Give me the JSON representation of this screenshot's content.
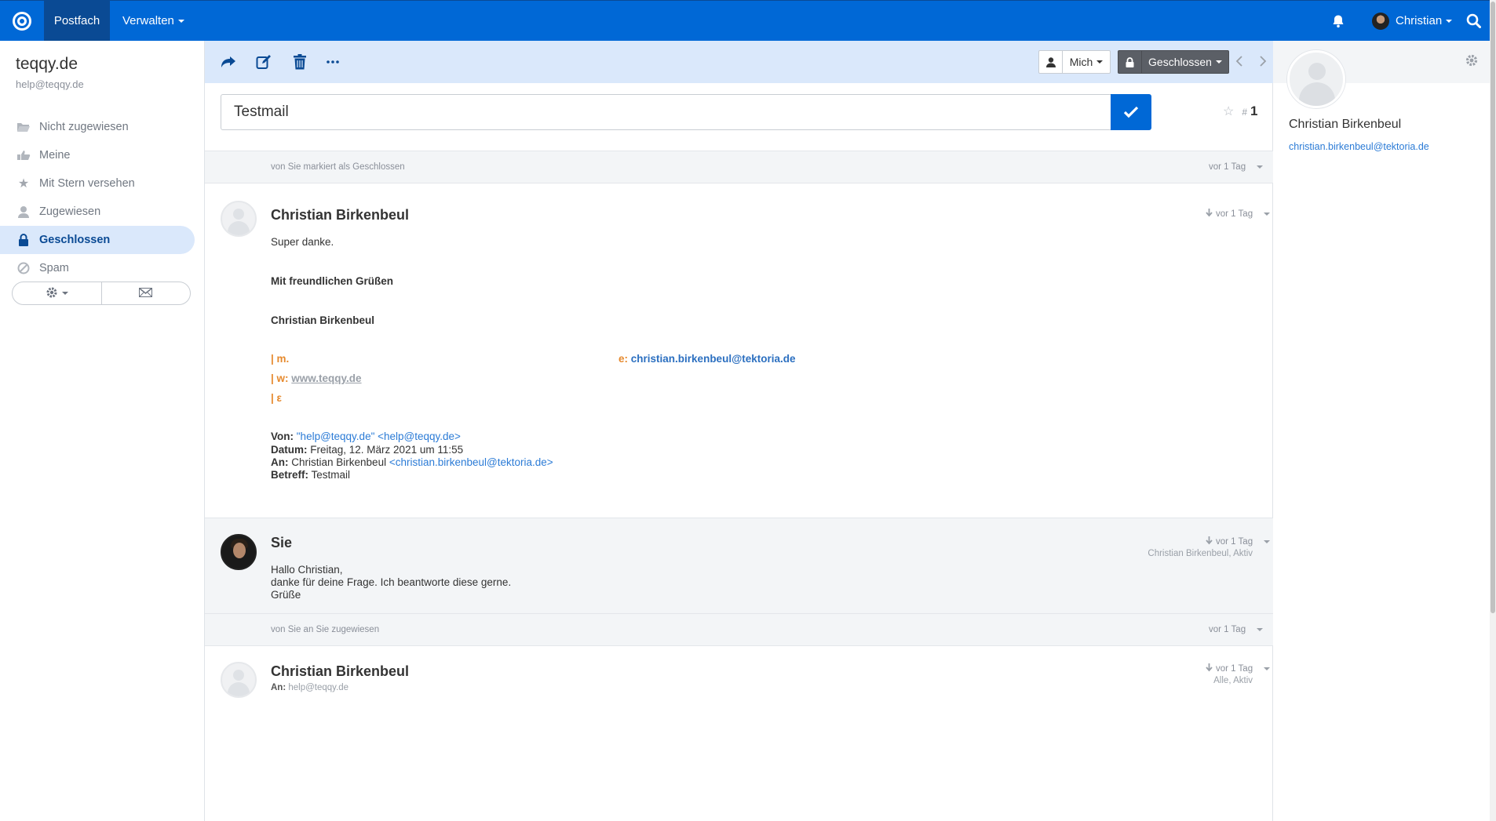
{
  "topbar": {
    "nav_inbox": "Postfach",
    "nav_manage": "Verwalten",
    "user_name": "Christian"
  },
  "sidebar": {
    "mailbox_name": "teqqy.de",
    "mailbox_email": "help@teqqy.de",
    "folders": [
      {
        "label": "Nicht zugewiesen",
        "icon": "folder-open-icon"
      },
      {
        "label": "Meine",
        "icon": "hand-point-icon"
      },
      {
        "label": "Mit Stern versehen",
        "icon": "star-icon"
      },
      {
        "label": "Zugewiesen",
        "icon": "user-icon"
      },
      {
        "label": "Geschlossen",
        "icon": "lock-icon"
      },
      {
        "label": "Spam",
        "icon": "ban-icon"
      }
    ],
    "active_folder": "Geschlossen"
  },
  "toolbar": {
    "assignee": "Mich",
    "status": "Geschlossen"
  },
  "conversation": {
    "subject": "Testmail",
    "number_prefix": "#",
    "number": "1"
  },
  "thread": {
    "event1": {
      "text": "von Sie markiert als Geschlossen",
      "time": "vor 1 Tag"
    },
    "msg1": {
      "sender": "Christian Birkenbeul",
      "time": "vor 1 Tag",
      "line1": "Super danke.",
      "greeting": "Mit freundlichen Grüßen",
      "signature_name": "Christian Birkenbeul",
      "sig_m_label": "| m.",
      "sig_e_label": "e:",
      "sig_e_value": "christian.birkenbeul@tektoria.de",
      "sig_w_label": "| w:",
      "sig_w_value": "www.teqqy.de",
      "sig_extra": "| ε",
      "from_label": "Von:",
      "from_value": "\"help@teqqy.de\" <help@teqqy.de>",
      "date_label": "Datum:",
      "date_value": "Freitag, 12. März 2021 um 11:55",
      "to_label": "An:",
      "to_name": "Christian Birkenbeul",
      "to_email": "<christian.birkenbeul@tektoria.de>",
      "subject_label": "Betreff:",
      "subject_value": "Testmail"
    },
    "msg2": {
      "sender": "Sie",
      "time": "vor 1 Tag",
      "sub": "Christian Birkenbeul, Aktiv",
      "line1": "Hallo Christian,",
      "line2": "danke für deine Frage. Ich beantworte diese gerne.",
      "line3": "Grüße"
    },
    "event2": {
      "text": "von Sie an Sie zugewiesen",
      "time": "vor 1 Tag"
    },
    "msg3": {
      "sender": "Christian Birkenbeul",
      "time": "vor 1 Tag",
      "sub": "Alle, Aktiv",
      "to_label": "An:",
      "to_value": "help@teqqy.de"
    }
  },
  "customer": {
    "name": "Christian Birkenbeul",
    "email": "christian.birkenbeul@tektoria.de"
  },
  "colors": {
    "brand": "#0068d6",
    "brand_dark": "#0a4a94",
    "toolbar_bg": "#dae8fb",
    "status_closed": "#5b5f66"
  }
}
